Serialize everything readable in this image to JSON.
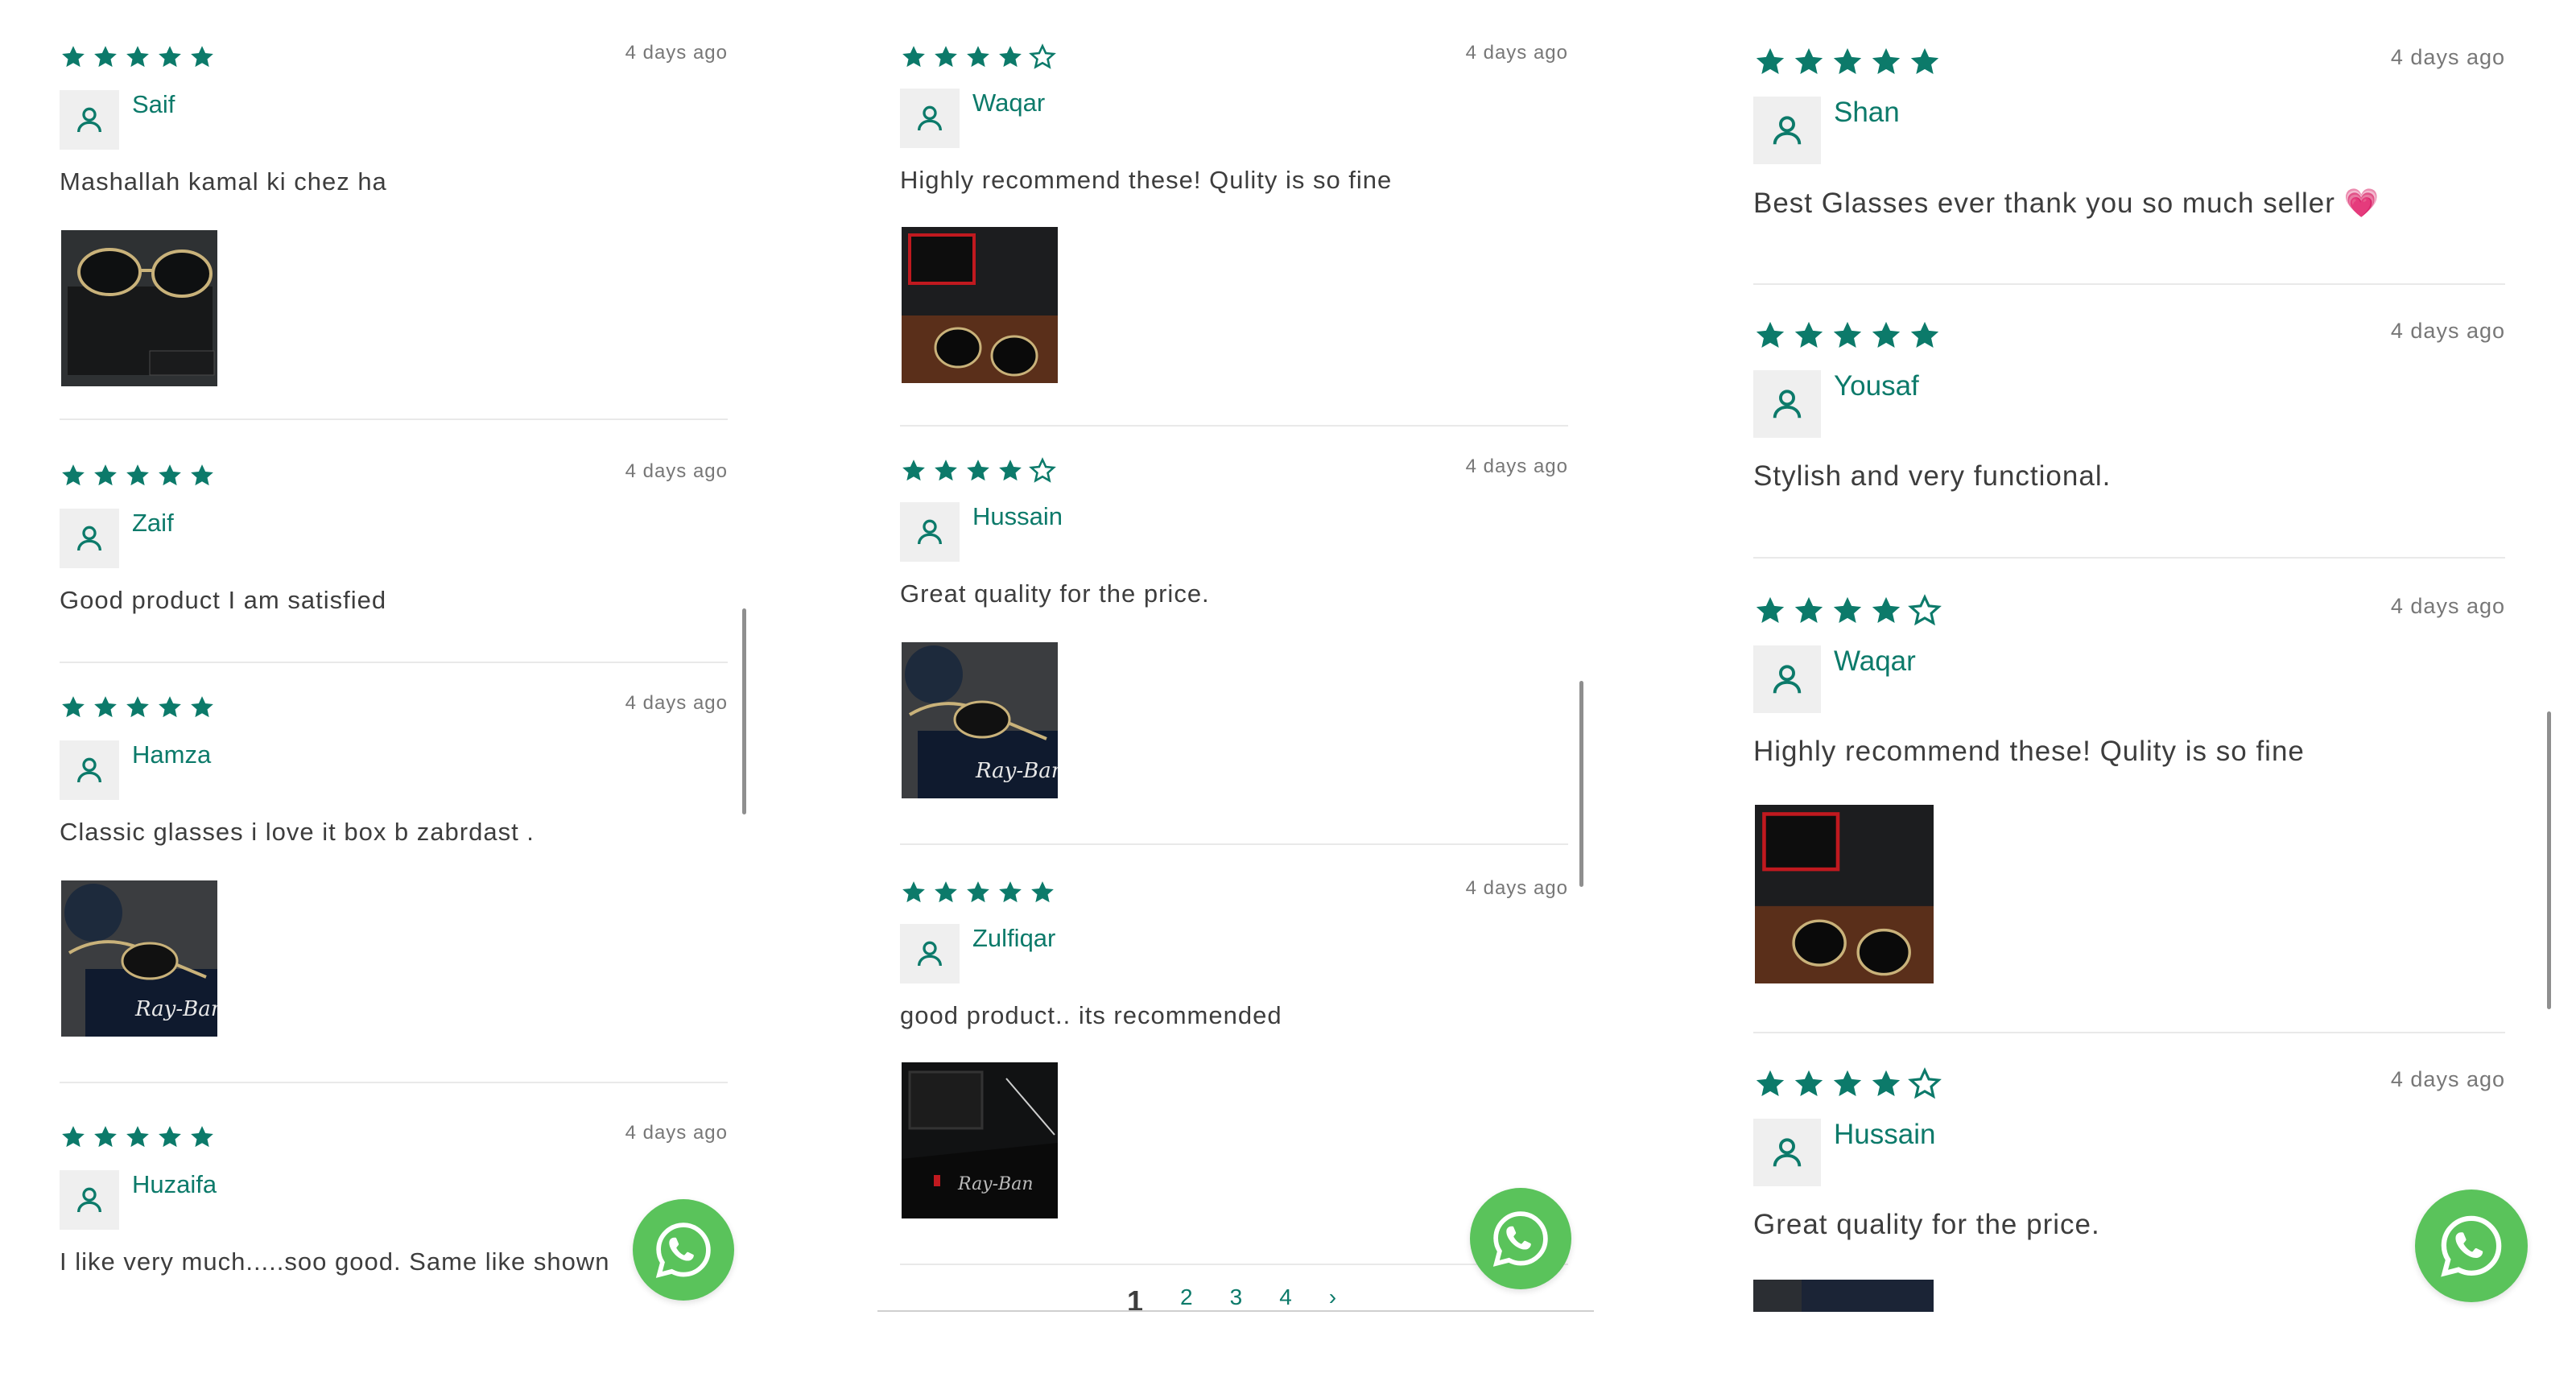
{
  "colors": {
    "accent": "#0c7a6a",
    "star": "#0c7a6a",
    "whatsapp": "#5ac35b",
    "divider": "#e9e9e9"
  },
  "icons": {
    "star": "star-icon",
    "avatar": "user-icon",
    "whatsapp": "whatsapp-icon"
  },
  "columns": [
    {
      "reviews": [
        {
          "rating": 5,
          "date": "4 days ago",
          "author": "Saif",
          "text": "Mashallah kamal ki chez ha",
          "has_photo": true,
          "photo": "sunglasses-on-black-case"
        },
        {
          "rating": 5,
          "date": "4 days ago",
          "author": "Zaif",
          "text": "Good product I am satisfied",
          "has_photo": false
        },
        {
          "rating": 5,
          "date": "4 days ago",
          "author": "Hamza",
          "text": "Classic glasses i love it box b zabrdast .",
          "has_photo": true,
          "photo": "ray-ban-box-and-glasses"
        },
        {
          "rating": 5,
          "date": "4 days ago",
          "author": "Huzaifa",
          "text": "I like very much.....soo good. Same like shown",
          "has_photo": false
        }
      ]
    },
    {
      "reviews": [
        {
          "rating": 4,
          "date": "4 days ago",
          "author": "Waqar",
          "text": "Highly recommend these! Qulity is so fine",
          "has_photo": true,
          "photo": "glasses-on-leather"
        },
        {
          "rating": 4,
          "date": "4 days ago",
          "author": "Hussain",
          "text": "Great quality for the price.",
          "has_photo": true,
          "photo": "ray-ban-box-and-glasses"
        },
        {
          "rating": 5,
          "date": "4 days ago",
          "author": "Zulfiqar",
          "text": "good product.. its recommended",
          "has_photo": true,
          "photo": "glasses-in-dark-case"
        }
      ],
      "pagination": [
        "1",
        "2",
        "3",
        "4",
        "›"
      ]
    },
    {
      "reviews": [
        {
          "rating": 5,
          "date": "4 days ago",
          "author": "Shan",
          "text": "Best Glasses ever thank you so much seller 💗",
          "has_photo": false
        },
        {
          "rating": 5,
          "date": "4 days ago",
          "author": "Yousaf",
          "text": "Stylish and very functional.",
          "has_photo": false
        },
        {
          "rating": 4,
          "date": "4 days ago",
          "author": "Waqar",
          "text": "Highly recommend these! Qulity is so fine",
          "has_photo": true,
          "photo": "glasses-on-leather"
        },
        {
          "rating": 4,
          "date": "4 days ago",
          "author": "Hussain",
          "text": "Great quality for the price.",
          "has_photo": false
        }
      ]
    }
  ]
}
